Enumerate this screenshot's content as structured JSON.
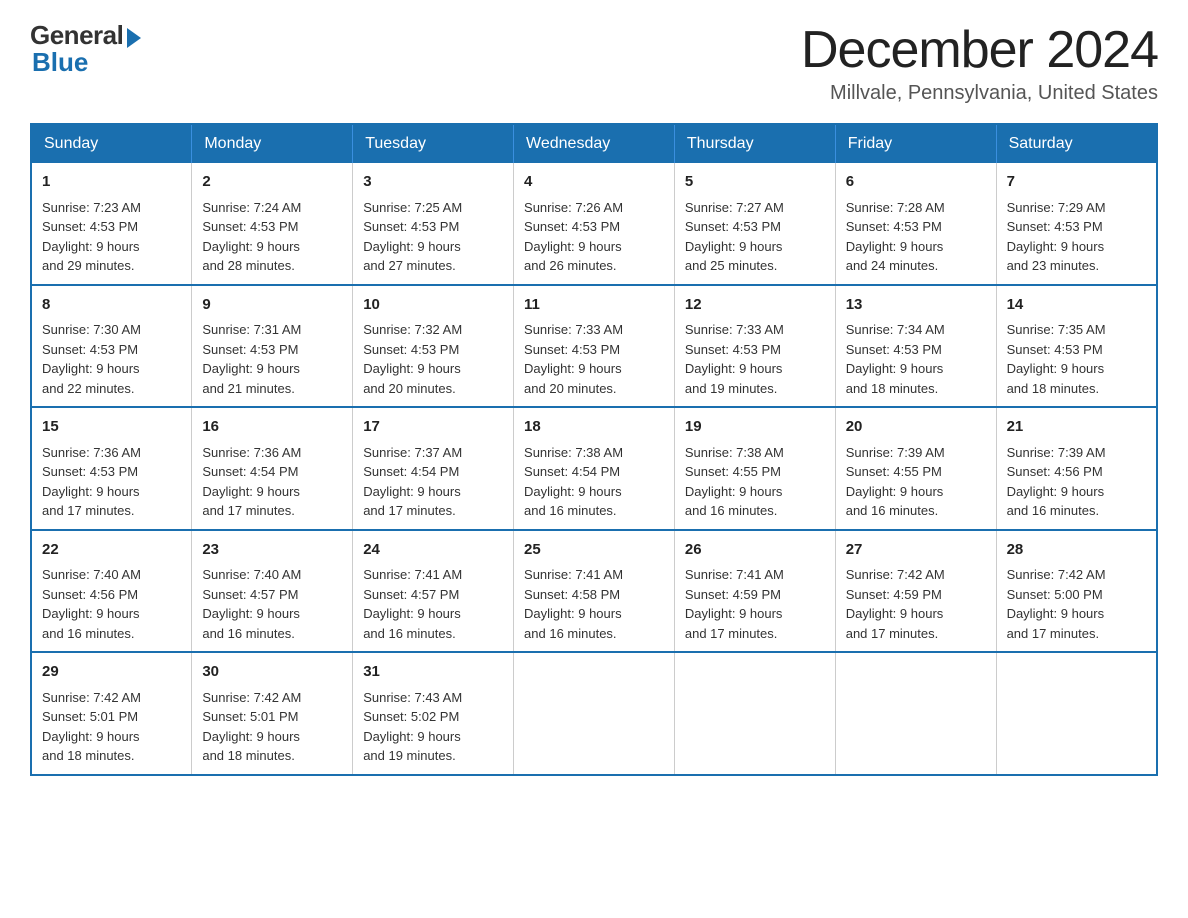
{
  "header": {
    "logo_general": "General",
    "logo_blue": "Blue",
    "month_title": "December 2024",
    "location": "Millvale, Pennsylvania, United States"
  },
  "days_of_week": [
    "Sunday",
    "Monday",
    "Tuesday",
    "Wednesday",
    "Thursday",
    "Friday",
    "Saturday"
  ],
  "weeks": [
    [
      {
        "day": "1",
        "sunrise": "7:23 AM",
        "sunset": "4:53 PM",
        "daylight": "9 hours and 29 minutes."
      },
      {
        "day": "2",
        "sunrise": "7:24 AM",
        "sunset": "4:53 PM",
        "daylight": "9 hours and 28 minutes."
      },
      {
        "day": "3",
        "sunrise": "7:25 AM",
        "sunset": "4:53 PM",
        "daylight": "9 hours and 27 minutes."
      },
      {
        "day": "4",
        "sunrise": "7:26 AM",
        "sunset": "4:53 PM",
        "daylight": "9 hours and 26 minutes."
      },
      {
        "day": "5",
        "sunrise": "7:27 AM",
        "sunset": "4:53 PM",
        "daylight": "9 hours and 25 minutes."
      },
      {
        "day": "6",
        "sunrise": "7:28 AM",
        "sunset": "4:53 PM",
        "daylight": "9 hours and 24 minutes."
      },
      {
        "day": "7",
        "sunrise": "7:29 AM",
        "sunset": "4:53 PM",
        "daylight": "9 hours and 23 minutes."
      }
    ],
    [
      {
        "day": "8",
        "sunrise": "7:30 AM",
        "sunset": "4:53 PM",
        "daylight": "9 hours and 22 minutes."
      },
      {
        "day": "9",
        "sunrise": "7:31 AM",
        "sunset": "4:53 PM",
        "daylight": "9 hours and 21 minutes."
      },
      {
        "day": "10",
        "sunrise": "7:32 AM",
        "sunset": "4:53 PM",
        "daylight": "9 hours and 20 minutes."
      },
      {
        "day": "11",
        "sunrise": "7:33 AM",
        "sunset": "4:53 PM",
        "daylight": "9 hours and 20 minutes."
      },
      {
        "day": "12",
        "sunrise": "7:33 AM",
        "sunset": "4:53 PM",
        "daylight": "9 hours and 19 minutes."
      },
      {
        "day": "13",
        "sunrise": "7:34 AM",
        "sunset": "4:53 PM",
        "daylight": "9 hours and 18 minutes."
      },
      {
        "day": "14",
        "sunrise": "7:35 AM",
        "sunset": "4:53 PM",
        "daylight": "9 hours and 18 minutes."
      }
    ],
    [
      {
        "day": "15",
        "sunrise": "7:36 AM",
        "sunset": "4:53 PM",
        "daylight": "9 hours and 17 minutes."
      },
      {
        "day": "16",
        "sunrise": "7:36 AM",
        "sunset": "4:54 PM",
        "daylight": "9 hours and 17 minutes."
      },
      {
        "day": "17",
        "sunrise": "7:37 AM",
        "sunset": "4:54 PM",
        "daylight": "9 hours and 17 minutes."
      },
      {
        "day": "18",
        "sunrise": "7:38 AM",
        "sunset": "4:54 PM",
        "daylight": "9 hours and 16 minutes."
      },
      {
        "day": "19",
        "sunrise": "7:38 AM",
        "sunset": "4:55 PM",
        "daylight": "9 hours and 16 minutes."
      },
      {
        "day": "20",
        "sunrise": "7:39 AM",
        "sunset": "4:55 PM",
        "daylight": "9 hours and 16 minutes."
      },
      {
        "day": "21",
        "sunrise": "7:39 AM",
        "sunset": "4:56 PM",
        "daylight": "9 hours and 16 minutes."
      }
    ],
    [
      {
        "day": "22",
        "sunrise": "7:40 AM",
        "sunset": "4:56 PM",
        "daylight": "9 hours and 16 minutes."
      },
      {
        "day": "23",
        "sunrise": "7:40 AM",
        "sunset": "4:57 PM",
        "daylight": "9 hours and 16 minutes."
      },
      {
        "day": "24",
        "sunrise": "7:41 AM",
        "sunset": "4:57 PM",
        "daylight": "9 hours and 16 minutes."
      },
      {
        "day": "25",
        "sunrise": "7:41 AM",
        "sunset": "4:58 PM",
        "daylight": "9 hours and 16 minutes."
      },
      {
        "day": "26",
        "sunrise": "7:41 AM",
        "sunset": "4:59 PM",
        "daylight": "9 hours and 17 minutes."
      },
      {
        "day": "27",
        "sunrise": "7:42 AM",
        "sunset": "4:59 PM",
        "daylight": "9 hours and 17 minutes."
      },
      {
        "day": "28",
        "sunrise": "7:42 AM",
        "sunset": "5:00 PM",
        "daylight": "9 hours and 17 minutes."
      }
    ],
    [
      {
        "day": "29",
        "sunrise": "7:42 AM",
        "sunset": "5:01 PM",
        "daylight": "9 hours and 18 minutes."
      },
      {
        "day": "30",
        "sunrise": "7:42 AM",
        "sunset": "5:01 PM",
        "daylight": "9 hours and 18 minutes."
      },
      {
        "day": "31",
        "sunrise": "7:43 AM",
        "sunset": "5:02 PM",
        "daylight": "9 hours and 19 minutes."
      },
      null,
      null,
      null,
      null
    ]
  ],
  "labels": {
    "sunrise": "Sunrise:",
    "sunset": "Sunset:",
    "daylight": "Daylight:"
  }
}
